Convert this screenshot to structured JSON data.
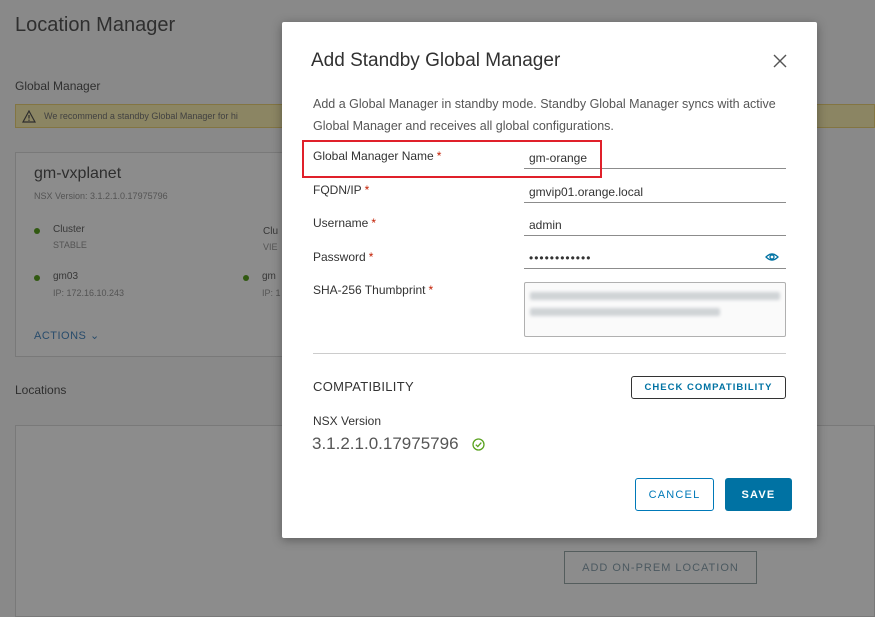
{
  "background": {
    "page_title": "Location Manager",
    "global_manager_heading": "Global Manager",
    "warning_text": "We recommend a standby Global Manager for hi",
    "card": {
      "name": "gm-vxplanet",
      "version": "NSX Version: 3.1.2.1.0.17975796",
      "cluster_label": "Cluster",
      "cluster_status": "STABLE",
      "cluster2_label": "Clu",
      "cluster2_status": "VIE",
      "node_name": "gm03",
      "node_ip": "IP: 172.16.10.243",
      "node2_name": "gm",
      "node2_ip": "IP: 1",
      "actions_label": "ACTIONS ⌄"
    },
    "locations_heading": "Locations",
    "add_location_label": "ADD ON-PREM LOCATION"
  },
  "modal": {
    "title": "Add Standby Global Manager",
    "description": "Add a Global Manager in standby mode. Standby Global Manager syncs with active Global Manager and receives all global configurations.",
    "fields": {
      "gm_name": {
        "label": "Global Manager Name",
        "required": "*",
        "value": "gm-orange"
      },
      "fqdn": {
        "label": "FQDN/IP",
        "required": "*",
        "value": "gmvip01.orange.local"
      },
      "username": {
        "label": "Username",
        "required": "*",
        "value": "admin"
      },
      "password": {
        "label": "Password",
        "required": "*",
        "value": "••••••••••••"
      },
      "thumbprint": {
        "label": "SHA-256 Thumbprint",
        "required": "*"
      }
    },
    "compatibility": {
      "heading": "COMPATIBILITY",
      "check_button": "CHECK COMPATIBILITY",
      "nsx_version_label": "NSX Version",
      "nsx_version_value": "3.1.2.1.0.17975796"
    },
    "buttons": {
      "cancel": "CANCEL",
      "save": "SAVE"
    }
  },
  "colors": {
    "primary": "#0072a3",
    "required": "#c21d00",
    "highlight": "#e0202a",
    "success": "#5aa220",
    "warning_bg": "#fef3b5"
  }
}
